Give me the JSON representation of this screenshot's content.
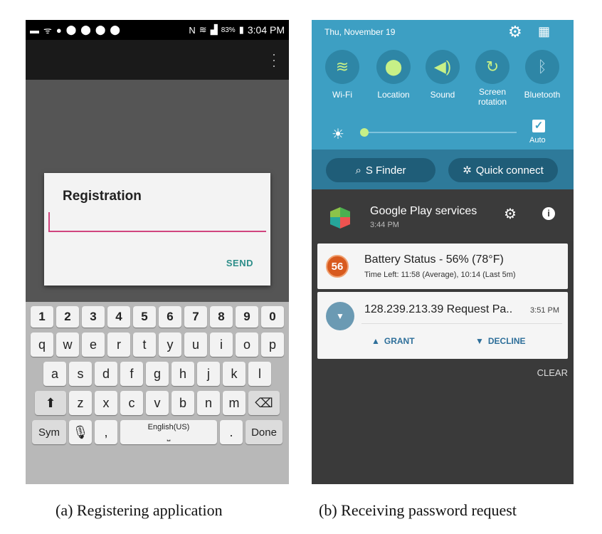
{
  "phone_a": {
    "status": {
      "time": "3:04 PM",
      "battery": "83%"
    },
    "dialog": {
      "title": "Registration",
      "input_value": "",
      "send_label": "SEND"
    },
    "keyboard": {
      "number_row": [
        "1",
        "2",
        "3",
        "4",
        "5",
        "6",
        "7",
        "8",
        "9",
        "0"
      ],
      "row1": [
        "q",
        "w",
        "e",
        "r",
        "t",
        "y",
        "u",
        "i",
        "o",
        "p"
      ],
      "row2": [
        "a",
        "s",
        "d",
        "f",
        "g",
        "h",
        "j",
        "k",
        "l"
      ],
      "row3": [
        "z",
        "x",
        "c",
        "v",
        "b",
        "n",
        "m"
      ],
      "sym_label": "Sym",
      "comma_label": ",",
      "space_label": "English(US)",
      "period_label": ".",
      "done_label": "Done"
    }
  },
  "phone_b": {
    "date": "Thu, November 19",
    "toggles": [
      {
        "label": "Wi-Fi",
        "icon": "wifi-icon",
        "color": "#c7f087"
      },
      {
        "label": "Location",
        "icon": "location-icon",
        "color": "#c7f087"
      },
      {
        "label": "Sound",
        "icon": "sound-icon",
        "color": "#c7f087"
      },
      {
        "label": "Screen rotation",
        "icon": "rotation-icon",
        "color": "#c7f087"
      },
      {
        "label": "Bluetooth",
        "icon": "bluetooth-icon",
        "color": "#a9d4e4"
      }
    ],
    "brightness": {
      "level": 0.0,
      "auto_label": "Auto",
      "auto_checked": true
    },
    "buttons": {
      "finder": "S Finder",
      "quick_connect": "Quick connect"
    },
    "google_play": {
      "name": "Google Play services",
      "time": "3:44 PM"
    },
    "battery_notification": {
      "badge": "56",
      "title": "Battery Status - 56% (78°F)",
      "subtitle": "Time Left: 11:58 (Average), 10:14 (Last 5m)"
    },
    "request_notification": {
      "title": "128.239.213.39 Request Pa..",
      "time": "3:51 PM",
      "grant": "GRANT",
      "decline": "DECLINE"
    },
    "clear_label": "CLEAR"
  },
  "captions": {
    "a": "(a) Registering application",
    "b": "(b) Receiving password request"
  }
}
